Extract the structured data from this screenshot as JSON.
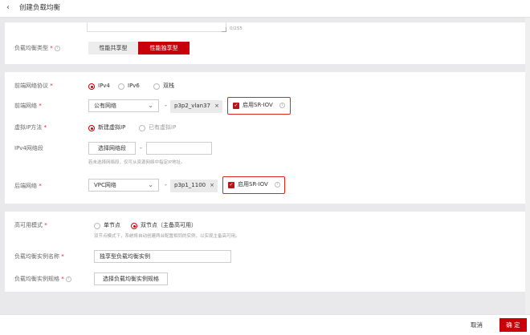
{
  "header": {
    "back_icon": "chevron-left-icon",
    "title": "创建负载均衡"
  },
  "top_remnant": {
    "counter": "0/255"
  },
  "lb_type": {
    "label": "负载均衡类型",
    "required": "*",
    "options": [
      "性能共享型",
      "性能独享型"
    ],
    "selected": "性能独享型"
  },
  "frontend_protocol": {
    "label": "前端网络协议",
    "required": "*",
    "options": [
      "IPv4",
      "IPv6",
      "双栈"
    ],
    "selected": "IPv4"
  },
  "frontend_network": {
    "label": "前端网络",
    "required": "*",
    "select_value": "公有网络",
    "dash": "-",
    "tag": "p3p2_vlan37",
    "tag_close": "×",
    "checkbox_label": "启用SR-IOV",
    "checked": true
  },
  "vip_method": {
    "label": "虚拟IP方法",
    "required": "*",
    "options": [
      "新建虚拟IP",
      "已有虚拟IP"
    ],
    "selected": "新建虚拟IP"
  },
  "ipv4_segment": {
    "label": "IPv4网络段",
    "button": "选择网络段",
    "dash": "-",
    "input_value": "",
    "hint": "若未选择网络段，仅可从资源网络中指定IP地址。"
  },
  "backend_network": {
    "label": "后端网络",
    "required": "*",
    "select_value": "VPC网络",
    "dash": "-",
    "tag": "p3p1_1100",
    "tag_close": "×",
    "checkbox_label": "启用SR-IOV",
    "checked": true
  },
  "ha_mode": {
    "label": "高可用模式",
    "required": "*",
    "options": [
      "单节点",
      "双节点（主备高可用）"
    ],
    "selected": "双节点（主备高可用）",
    "hint": "双节点模式下，系统将自动创建两台配置相同的实例，以实现主备高可用。"
  },
  "instance_name": {
    "label": "负载均衡实例名称",
    "required": "*",
    "value": "独享型负载均衡实例"
  },
  "instance_spec": {
    "label": "负载均衡实例规格",
    "required": "*",
    "button": "选择负载均衡实例规格"
  },
  "footer": {
    "cancel": "取消",
    "confirm": "确 定"
  },
  "colors": {
    "accent": "#c7000b",
    "highlight": "#d9271f"
  }
}
